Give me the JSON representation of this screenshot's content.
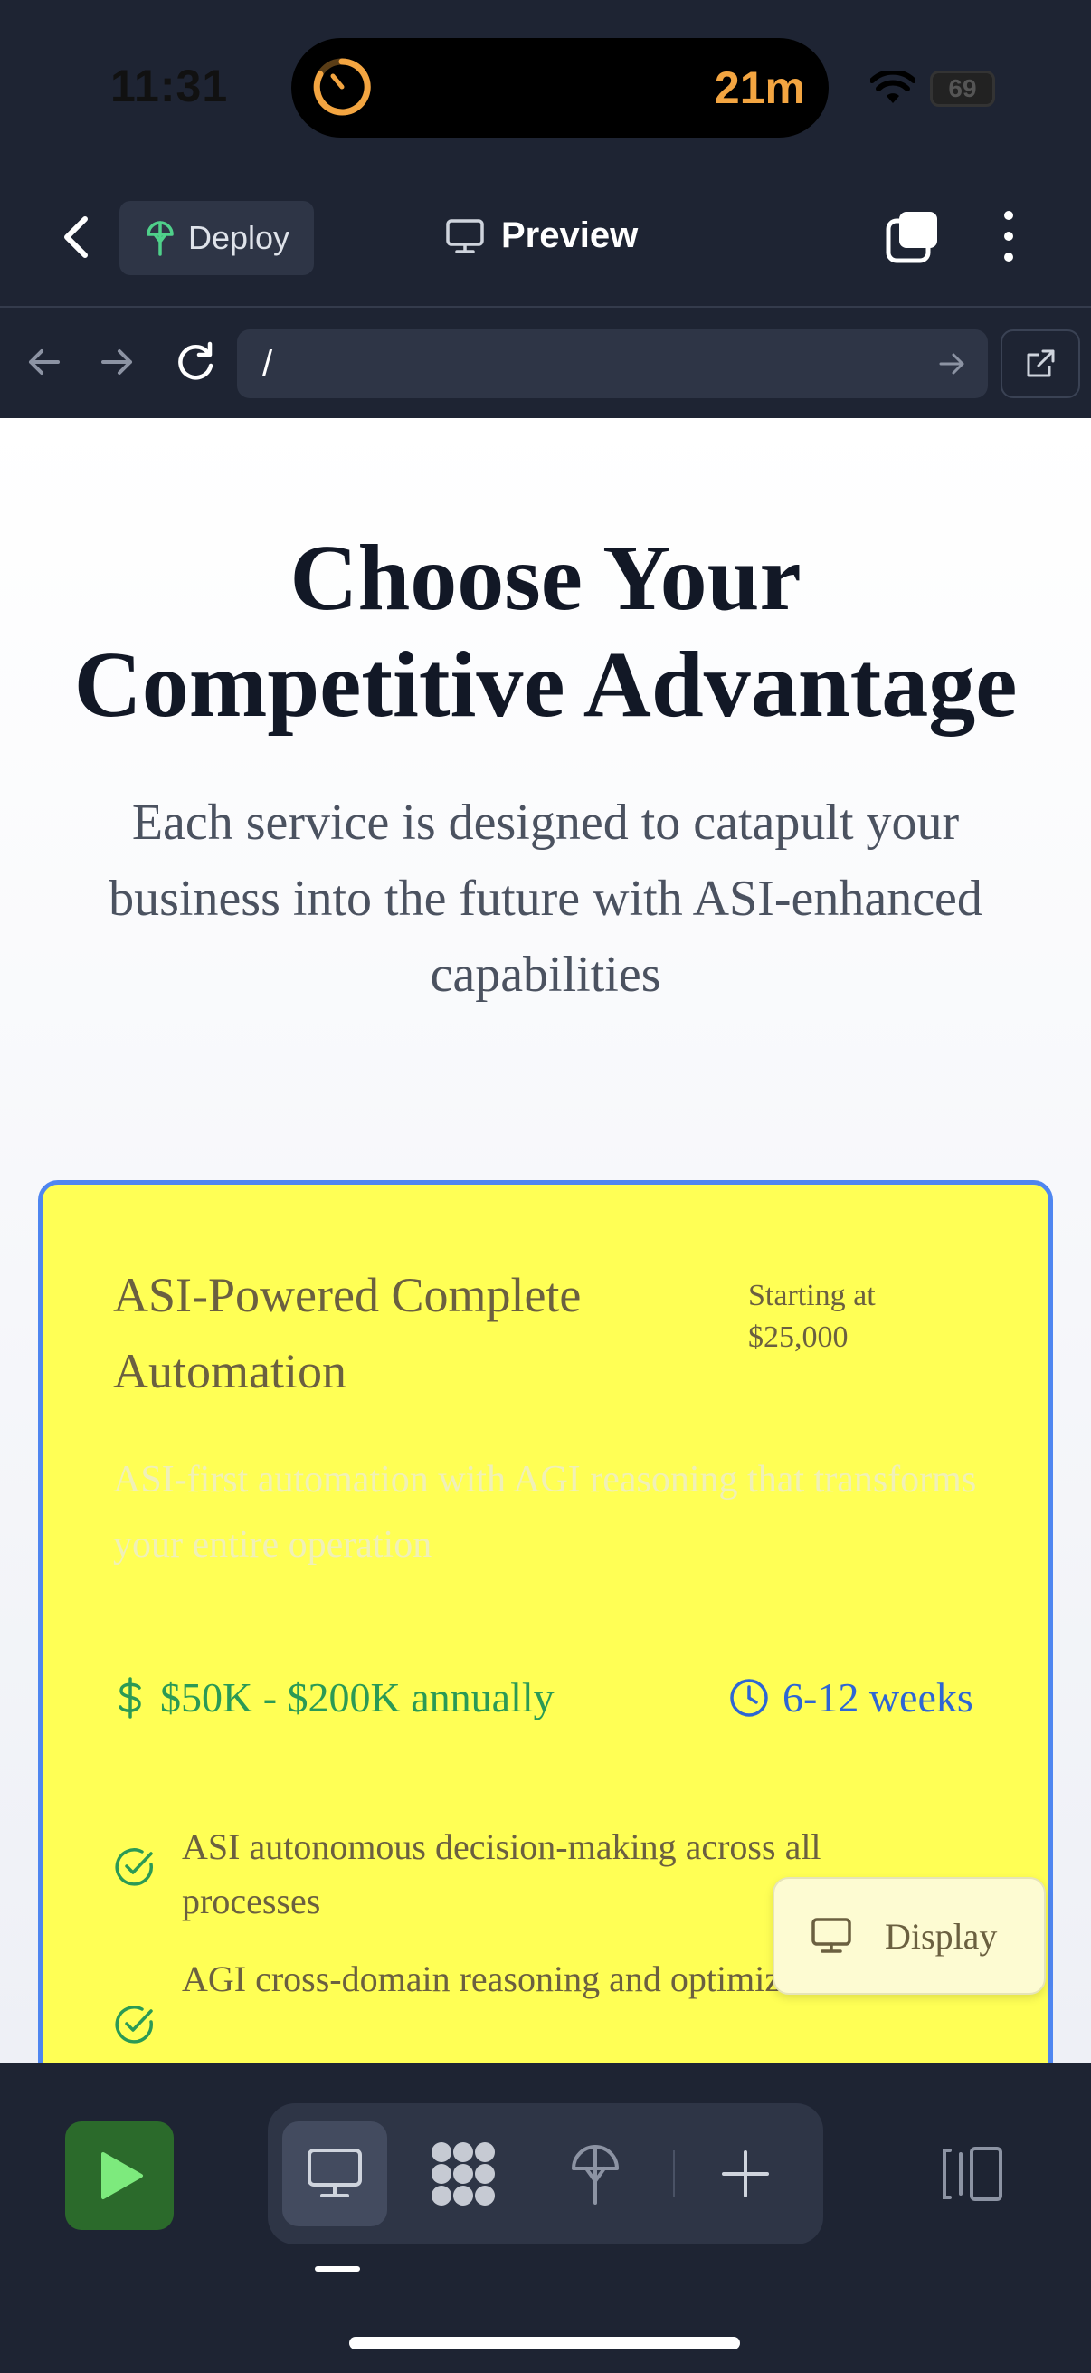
{
  "status": {
    "time": "11:31",
    "timer": "21m",
    "battery": "69"
  },
  "toolbar": {
    "deploy_label": "Deploy",
    "preview_label": "Preview"
  },
  "browser": {
    "url": "/"
  },
  "hero": {
    "title_line1": "Choose Your",
    "title_line2": "Competitive Advantage",
    "subtitle": "Each service is designed to catapult your business into the future with ASI-enhanced capabilities"
  },
  "card": {
    "title": "ASI-Powered Complete Automation",
    "price_prefix": "Starting at",
    "price": "$25,000",
    "description": "ASI-first automation with AGI reasoning that transforms your entire operation",
    "roi": "$50K - $200K annually",
    "timeline": "6-12 weeks",
    "features": [
      "ASI autonomous decision-making across all processes",
      "AGI cross-domain reasoning and optimization"
    ],
    "colors": {
      "background": "#ffff55",
      "border": "#4f86f0",
      "roi": "#2b9a55",
      "timeline": "#2e66d4"
    }
  },
  "overlay": {
    "display_label": "Display"
  },
  "bottom_bar": {
    "tools": [
      "monitor-icon",
      "apps-icon",
      "deploy-icon",
      "add-icon"
    ],
    "run_color": "#2b6a2b"
  }
}
